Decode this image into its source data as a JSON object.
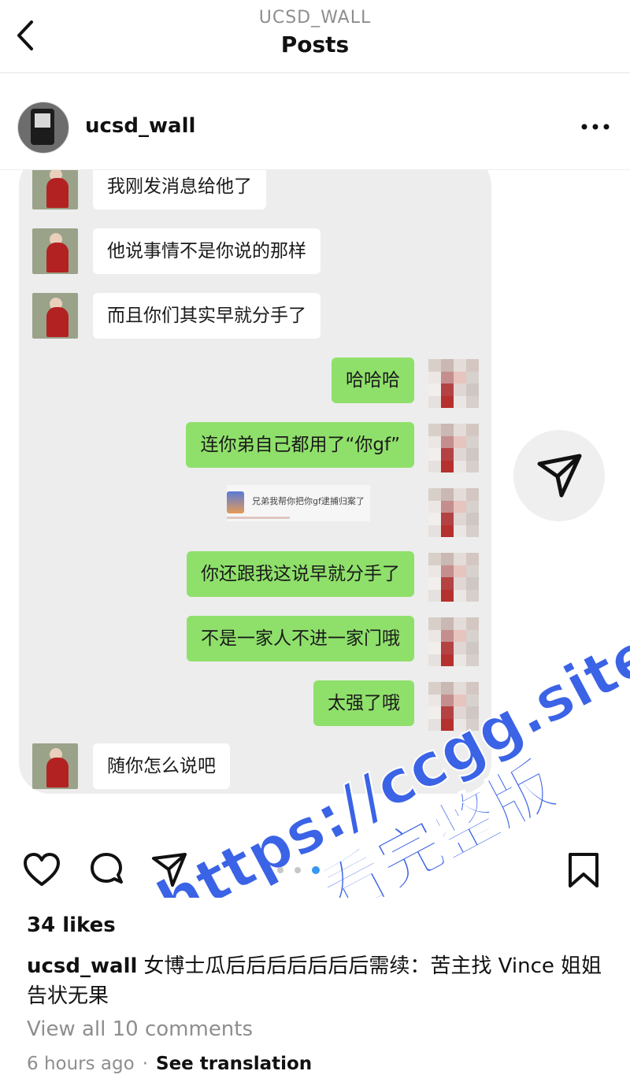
{
  "header": {
    "account": "UCSD_WALL",
    "title": "Posts"
  },
  "post": {
    "username": "ucsd_wall",
    "likes": "34 likes",
    "caption_user": "ucsd_wall",
    "caption_text": "女博士瓜后后后后后后后需续：苦主找 Vince 姐姐告状无果",
    "view_comments": "View all 10 comments",
    "time": "6 hours ago",
    "separator": "·",
    "see_translation": "See translation"
  },
  "chat": {
    "messages": [
      {
        "side": "left",
        "text": "我刚发消息给他了"
      },
      {
        "side": "left",
        "text": "他说事情不是你说的那样"
      },
      {
        "side": "left",
        "text": "而且你们其实早就分手了"
      },
      {
        "side": "right",
        "text": "哈哈哈"
      },
      {
        "side": "right",
        "text": "连你弟自己都用了“你gf”"
      },
      {
        "side": "right",
        "text": "兄弟我帮你把你gf逮捕归案了"
      },
      {
        "side": "right",
        "text": "你还跟我这说早就分手了"
      },
      {
        "side": "right",
        "text": "不是一家人不进一家门哦"
      },
      {
        "side": "right",
        "text": "太强了哦"
      },
      {
        "side": "left",
        "text": "随你怎么说吧"
      }
    ]
  },
  "watermark": {
    "line1": "https://ccgg.site",
    "line2": "看完整版"
  },
  "carousel": {
    "count": 3,
    "active": 3
  },
  "colors": {
    "bubble_right": "#8fe06b",
    "bubble_left": "#ffffff",
    "chat_bg": "#ededed",
    "watermark": "#3b63e6",
    "carousel_active": "#3897f0"
  },
  "icons": [
    "back-icon",
    "more-icon",
    "send-icon",
    "heart-icon",
    "comment-icon",
    "share-icon",
    "bookmark-icon"
  ]
}
